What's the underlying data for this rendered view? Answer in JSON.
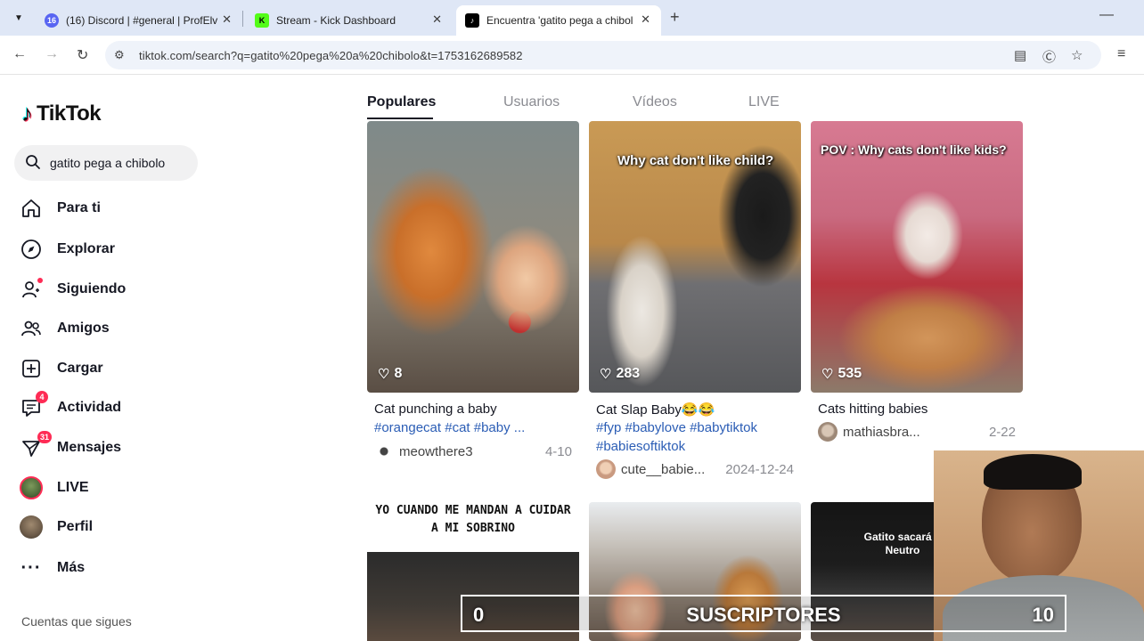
{
  "browser": {
    "tabs": [
      {
        "title": "(16) Discord | #general | ProfElv",
        "favicon_badge": "16"
      },
      {
        "title": "Stream - Kick Dashboard",
        "favicon_badge": "K"
      },
      {
        "title": "Encuentra 'gatito pega a chibolo",
        "favicon_badge": "♪"
      }
    ],
    "url": "tiktok.com/search?q=gatito%20pega%20a%20chibolo&t=1753162689582"
  },
  "tiktok": {
    "logo": "TikTok",
    "search_query": "gatito pega a chibolo",
    "nav": [
      {
        "label": "Para ti",
        "icon": "home-icon"
      },
      {
        "label": "Explorar",
        "icon": "compass-icon"
      },
      {
        "label": "Siguiendo",
        "icon": "following-icon"
      },
      {
        "label": "Amigos",
        "icon": "friends-icon"
      },
      {
        "label": "Cargar",
        "icon": "upload-icon"
      },
      {
        "label": "Actividad",
        "icon": "activity-icon",
        "badge": "4"
      },
      {
        "label": "Mensajes",
        "icon": "messages-icon",
        "badge": "31"
      },
      {
        "label": "LIVE",
        "icon": "live-icon"
      },
      {
        "label": "Perfil",
        "icon": "profile-icon"
      },
      {
        "label": "Más",
        "icon": "more-icon"
      }
    ],
    "following_title": "Cuentas que sigues"
  },
  "results": {
    "tabs": [
      "Populares",
      "Usuarios",
      "Vídeos",
      "LIVE"
    ],
    "active_tab": "Populares",
    "cards": [
      {
        "likes": "8",
        "title": "Cat punching a baby",
        "tags": "#orangecat #cat #baby ...",
        "author": "meowthere3",
        "date": "4-10",
        "overlay": ""
      },
      {
        "likes": "283",
        "title": "Cat Slap Baby😂😂",
        "tags": "#fyp #babylove #babytiktok #babiesoftiktok",
        "author": "cute__babie...",
        "date": "2024-12-24",
        "overlay": "Why cat don't like child?"
      },
      {
        "likes": "535",
        "title": "Cats hitting babies",
        "tags": "",
        "author": "mathiasbra...",
        "date": "2-22",
        "overlay": "POV : Why cats don't like kids?"
      }
    ],
    "row2": {
      "card1_caption": "YO CUANDO ME MANDAN A CUIDAR A MI SOBRINO",
      "card3_caption": "Gatito sacará u Neutro"
    }
  },
  "stream": {
    "sub_label": "SUSCRIPTORES",
    "sub_current": "0",
    "sub_goal": "10"
  }
}
